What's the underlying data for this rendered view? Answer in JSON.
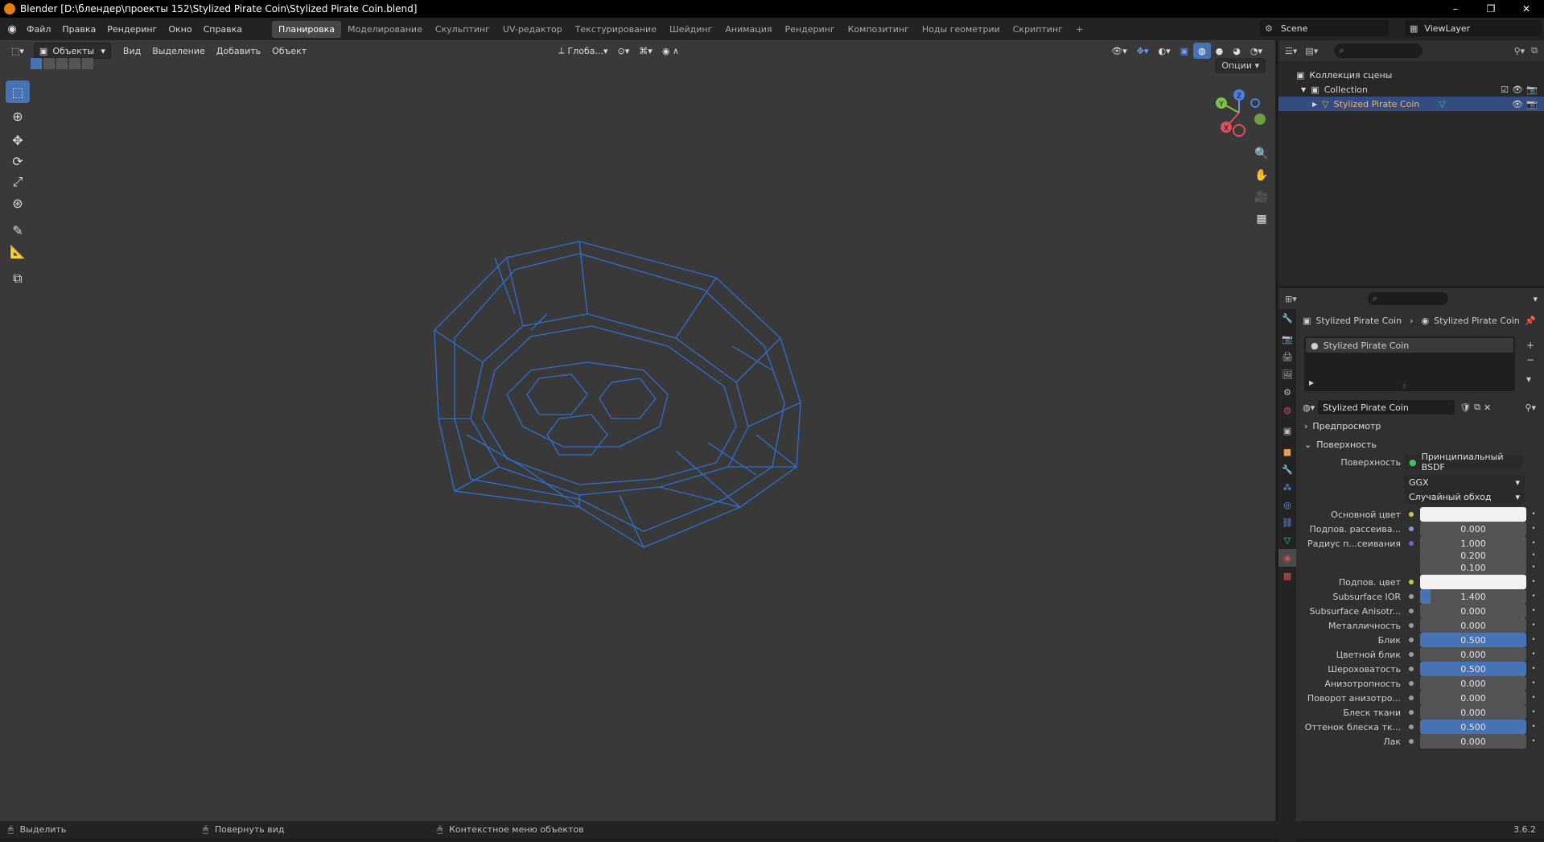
{
  "window": {
    "title": "Blender [D:\\блендер\\проекты 152\\Stylized Pirate Coin\\Stylized Pirate Coin.blend]",
    "minimize": "–",
    "maximize": "❐",
    "close": "✕"
  },
  "menus": [
    "Файл",
    "Правка",
    "Рендеринг",
    "Окно",
    "Справка"
  ],
  "workspaces": [
    "Планировка",
    "Моделирование",
    "Скульптинг",
    "UV-редактор",
    "Текстурирование",
    "Шейдинг",
    "Анимация",
    "Рендеринг",
    "Композитинг",
    "Ноды геометрии",
    "Скриптинг"
  ],
  "workspace_add": "+",
  "scene": {
    "label": "Scene",
    "viewlayer": "ViewLayer"
  },
  "viewport": {
    "mode": "Объекты",
    "menus": [
      "Вид",
      "Выделение",
      "Добавить",
      "Объект"
    ],
    "transform_orientation": "Глоба...",
    "options": "Опции",
    "gizmo": {
      "x": "X",
      "y": "Y",
      "z": "Z"
    },
    "wire_color": "#2f6fd0"
  },
  "outliner": {
    "scene_collection": "Коллекция сцены",
    "collection": "Collection",
    "object": "Stylized Pirate Coin"
  },
  "properties": {
    "breadcrumb": [
      "Stylized Pirate Coin",
      "Stylized Pirate Coin"
    ],
    "slot": "Stylized Pirate Coin",
    "material_name": "Stylized Pirate Coin",
    "sections": {
      "preview": "Предпросмотр",
      "surface": "Поверхность"
    },
    "surface_label": "Поверхность",
    "surface_shader": "Принципиальный BSDF",
    "distribution": "GGX",
    "subsurface_method": "Случайный обход",
    "rows": [
      {
        "label": "Основной цвет",
        "type": "color",
        "color": "#f2f2f2",
        "socket": "#c8c84a"
      },
      {
        "label": "Подпов. рассеива...",
        "type": "num",
        "value": "0.000",
        "fill": 0,
        "socket": "#8f8fcf"
      },
      {
        "label": "Радиус п...сеивания",
        "type": "num",
        "value": "1.000",
        "fill": 0,
        "socket": "#6a6ad0"
      },
      {
        "label": "",
        "type": "num",
        "value": "0.200",
        "fill": 0,
        "socket": ""
      },
      {
        "label": "",
        "type": "num",
        "value": "0.100",
        "fill": 0,
        "socket": ""
      },
      {
        "label": "Подпов. цвет",
        "type": "color",
        "color": "#f2f2f2",
        "socket": "#c8c84a"
      },
      {
        "label": "Subsurface IOR",
        "type": "num",
        "value": "1.400",
        "fill": 0.1,
        "socket": "#9a9a9a"
      },
      {
        "label": "Subsurface Anisotr...",
        "type": "num",
        "value": "0.000",
        "fill": 0,
        "socket": "#9a9a9a"
      },
      {
        "label": "Металличность",
        "type": "num",
        "value": "0.000",
        "fill": 0,
        "socket": "#9a9a9a"
      },
      {
        "label": "Блик",
        "type": "num",
        "value": "0.500",
        "fill": 1,
        "socket": "#9a9a9a"
      },
      {
        "label": "Цветной блик",
        "type": "num",
        "value": "0.000",
        "fill": 0,
        "socket": "#9a9a9a"
      },
      {
        "label": "Шероховатость",
        "type": "num",
        "value": "0.500",
        "fill": 1,
        "socket": "#9a9a9a"
      },
      {
        "label": "Анизотропность",
        "type": "num",
        "value": "0.000",
        "fill": 0,
        "socket": "#9a9a9a"
      },
      {
        "label": "Поворот анизотро...",
        "type": "num",
        "value": "0.000",
        "fill": 0,
        "socket": "#9a9a9a"
      },
      {
        "label": "Блеск ткани",
        "type": "num",
        "value": "0.000",
        "fill": 0,
        "socket": "#9a9a9a"
      },
      {
        "label": "Оттенок блеска тк...",
        "type": "num",
        "value": "0.500",
        "fill": 1,
        "socket": "#9a9a9a"
      },
      {
        "label": "Лак",
        "type": "num",
        "value": "0.000",
        "fill": 0,
        "socket": "#9a9a9a"
      }
    ]
  },
  "status": {
    "select": "Выделить",
    "rotate": "Повернуть вид",
    "context": "Контекстное меню объектов",
    "version": "3.6.2"
  },
  "colors": {
    "accent": "#4772b3",
    "selection": "#334d80"
  }
}
